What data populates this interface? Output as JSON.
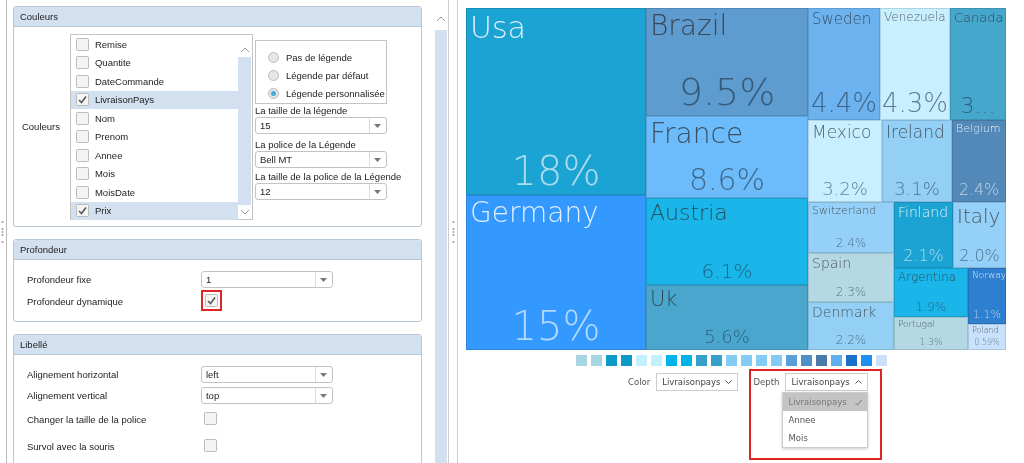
{
  "couleurs": {
    "title": "Couleurs",
    "field_label": "Couleurs",
    "items": [
      {
        "label": "Remise",
        "checked": false
      },
      {
        "label": "Quantite",
        "checked": false
      },
      {
        "label": "DateCommande",
        "checked": false
      },
      {
        "label": "LivraisonPays",
        "checked": true
      },
      {
        "label": "Nom",
        "checked": false
      },
      {
        "label": "Prenom",
        "checked": false
      },
      {
        "label": "Annee",
        "checked": false
      },
      {
        "label": "Mois",
        "checked": false
      },
      {
        "label": "MoisDate",
        "checked": false
      },
      {
        "label": "Prix",
        "checked": true
      }
    ],
    "legend_options": [
      {
        "label": "Pas de légende",
        "selected": false
      },
      {
        "label": "Légende par défaut",
        "selected": false
      },
      {
        "label": "Légende personnalisée",
        "selected": true
      }
    ],
    "fields": [
      {
        "label": "La taille de la légende",
        "value": "15"
      },
      {
        "label": "La police de la Légende",
        "value": "Bell MT"
      },
      {
        "label": "La taille de la police de la Légende",
        "value": "12"
      }
    ]
  },
  "profondeur": {
    "title": "Profondeur",
    "rows": [
      {
        "kind": "select",
        "label": "Profondeur fixe",
        "value": "1"
      },
      {
        "kind": "checkbox",
        "label": "Profondeur dynamique",
        "checked": true,
        "highlighted": true
      }
    ]
  },
  "libelle": {
    "title": "Libellé",
    "rows": [
      {
        "kind": "select",
        "label": "Alignement horizontal",
        "value": "left"
      },
      {
        "kind": "select",
        "label": "Alignement vertical",
        "value": "top"
      },
      {
        "kind": "checkbox",
        "label": "Changer la taille de la police",
        "checked": false,
        "highlighted": false
      },
      {
        "kind": "checkbox",
        "label": "Survol avec la souris",
        "checked": false,
        "highlighted": false
      }
    ]
  },
  "treemap": {
    "tiles": [
      {
        "name": "Usa",
        "value": "18%",
        "color": "#1ba3d3"
      },
      {
        "name": "Germany",
        "value": "15%",
        "color": "#3399ff"
      },
      {
        "name": "Brazil",
        "value": "9.5%",
        "color": "#5e9bcf"
      },
      {
        "name": "France",
        "value": "8.6%",
        "color": "#6cbbfa"
      },
      {
        "name": "Austria",
        "value": "6.1%",
        "color": "#1ab6ea"
      },
      {
        "name": "Uk",
        "value": "5.6%",
        "color": "#4aa6cc"
      },
      {
        "name": "Sweden",
        "value": "4.4%",
        "color": "#6cb2ee"
      },
      {
        "name": "Venezuela",
        "value": "4.3%",
        "color": "#c8efff"
      },
      {
        "name": "Canada",
        "value": "3...",
        "color": "#46a7cc"
      },
      {
        "name": "Mexico",
        "value": "3.2%",
        "color": "#c8efff"
      },
      {
        "name": "Ireland",
        "value": "3.1%",
        "color": "#94cff5"
      },
      {
        "name": "Belgium",
        "value": "2.4%",
        "color": "#5289b8"
      },
      {
        "name": "Switzerland",
        "value": "2.4%",
        "color": "#94d0f7"
      },
      {
        "name": "Spain",
        "value": "2.3%",
        "color": "#b4d9e4"
      },
      {
        "name": "Denmark",
        "value": "2.2%",
        "color": "#94cff5"
      },
      {
        "name": "Finland",
        "value": "2.1%",
        "color": "#1ba3d3"
      },
      {
        "name": "Italy",
        "value": "2.0%",
        "color": "#94d0f7"
      },
      {
        "name": "Argentina",
        "value": "1.9%",
        "color": "#1ab6ea"
      },
      {
        "name": "Portugal",
        "value": "1.3%",
        "color": "#b4d9e4"
      },
      {
        "name": "Norway",
        "value": "1.1%",
        "color": "#2e7fcf"
      },
      {
        "name": "Poland",
        "value": "0.59%",
        "color": "#c8e1fc"
      }
    ],
    "legend": [
      {
        "color": "#a8d5e2"
      },
      {
        "color": "#a8d5e2"
      },
      {
        "color": "#0d9ac6"
      },
      {
        "color": "#0d9ac6"
      },
      {
        "color": "#c4effc"
      },
      {
        "color": "#c4effc"
      },
      {
        "color": "#00b4ea"
      },
      {
        "color": "#00b4ea"
      },
      {
        "color": "#36a1c8"
      },
      {
        "color": "#36a1c8"
      },
      {
        "color": "#84cbf5"
      },
      {
        "color": "#84cbf5"
      },
      {
        "color": "#84cbf5"
      },
      {
        "color": "#84cbf5"
      },
      {
        "color": "#5aa0d8"
      },
      {
        "color": "#5090c6"
      },
      {
        "color": "#4a7ba8"
      },
      {
        "color": "#60b0f0"
      },
      {
        "color": "#1a70c8"
      },
      {
        "color": "#2090f0"
      },
      {
        "color": "#cce0fc"
      }
    ]
  },
  "controls": {
    "color": {
      "label": "Color",
      "value": "Livraisonpays",
      "expanded": false
    },
    "depth": {
      "label": "Depth",
      "value": "Livraisonpays",
      "expanded": true,
      "highlighted": true,
      "options": [
        {
          "label": "Livraisonpays",
          "selected": true
        },
        {
          "label": "Annee",
          "selected": false
        },
        {
          "label": "Mois",
          "selected": false
        }
      ]
    }
  }
}
